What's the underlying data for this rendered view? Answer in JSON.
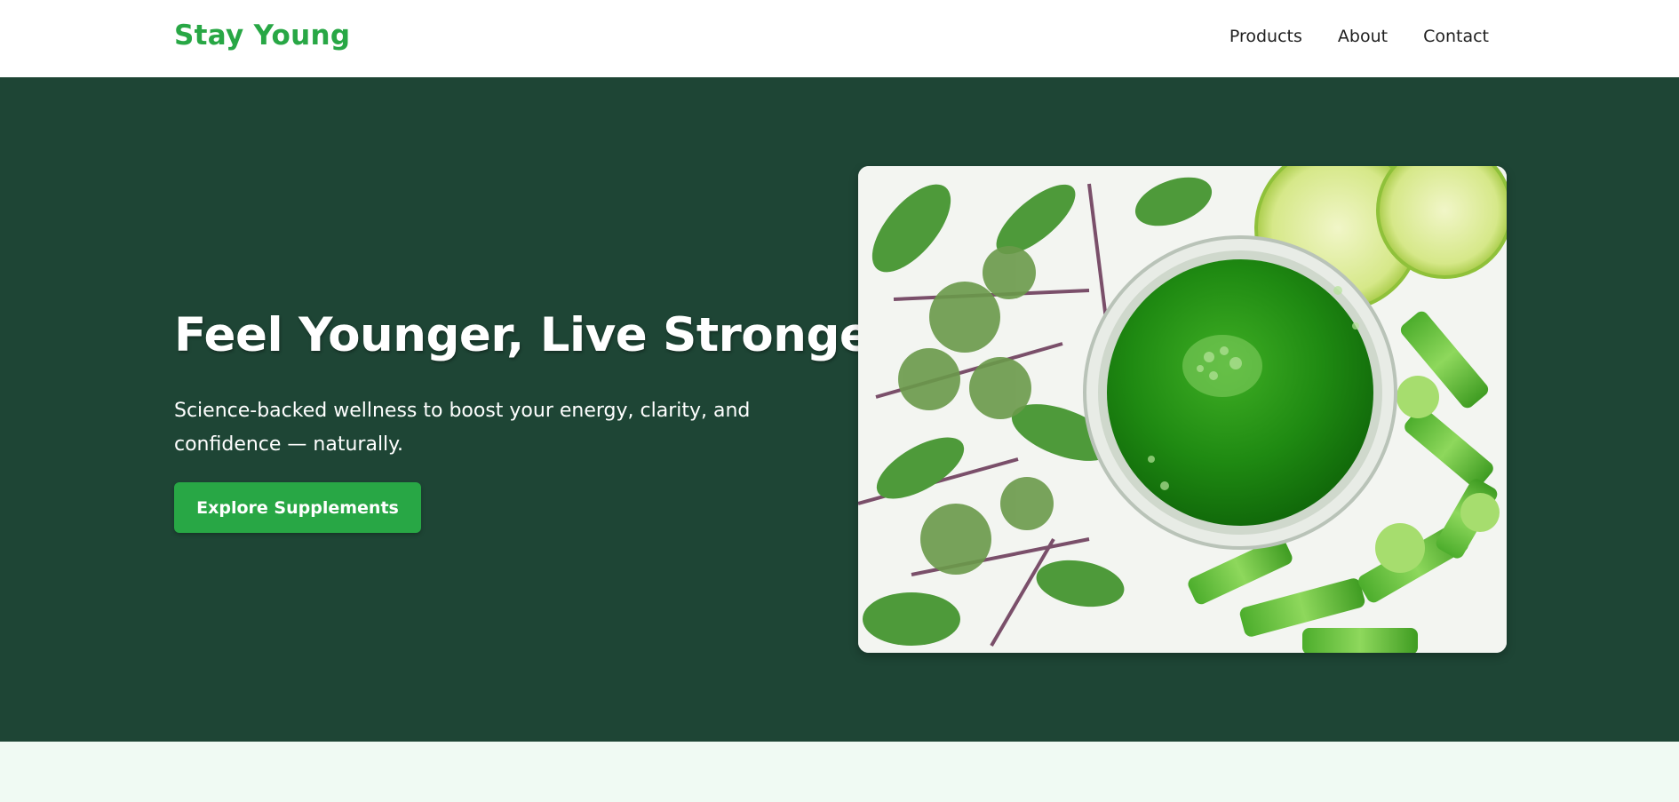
{
  "brand": {
    "name": "Stay Young",
    "color": "#28a745"
  },
  "nav": {
    "items": [
      "Products",
      "About",
      "Contact"
    ]
  },
  "hero": {
    "title": "Feel Younger, Live Stronger",
    "subtitle": "Science-backed wellness to boost your energy, clarity, and confidence — naturally.",
    "cta_label": "Explore Supplements",
    "background": "#1e4535",
    "image": "green-juice-with-herbs-lime-celery-photo"
  },
  "colors": {
    "accent": "#28a745",
    "hero_bg": "#1e4535",
    "page_bg": "#f0faf3"
  }
}
